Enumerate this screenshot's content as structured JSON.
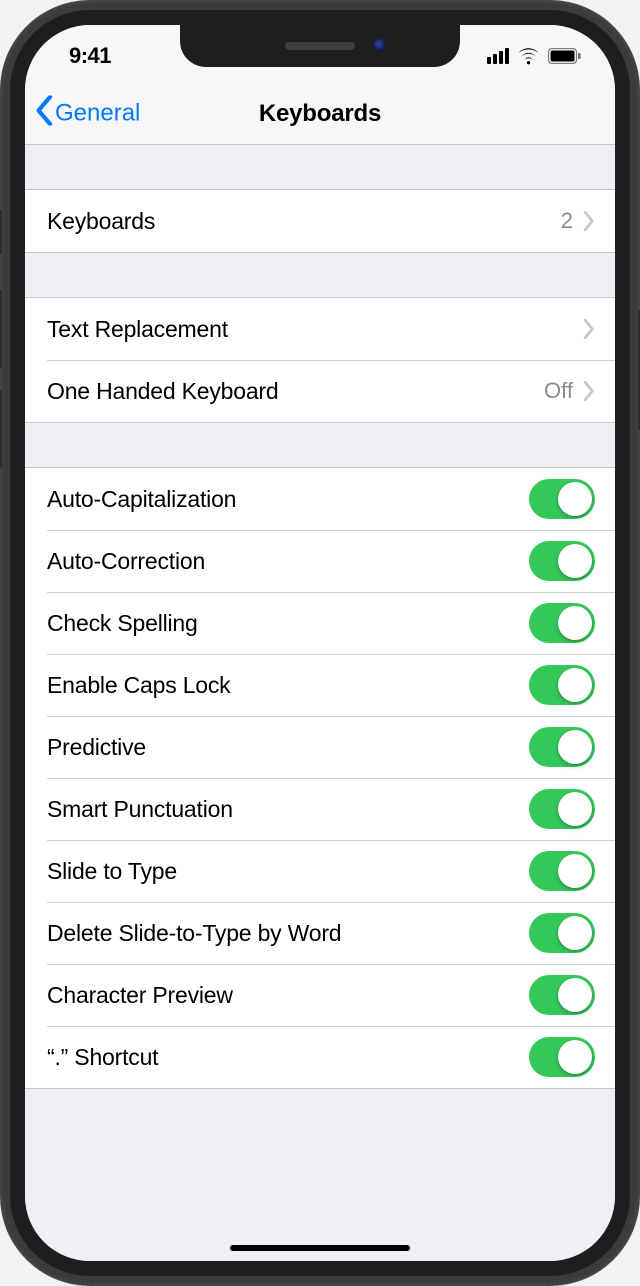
{
  "status": {
    "time": "9:41"
  },
  "nav": {
    "back_label": "General",
    "title": "Keyboards"
  },
  "group1": {
    "keyboards_label": "Keyboards",
    "keyboards_count": "2"
  },
  "group2": {
    "text_replacement_label": "Text Replacement",
    "one_handed_label": "One Handed Keyboard",
    "one_handed_value": "Off"
  },
  "toggles": [
    {
      "label": "Auto-Capitalization",
      "on": true
    },
    {
      "label": "Auto-Correction",
      "on": true
    },
    {
      "label": "Check Spelling",
      "on": true
    },
    {
      "label": "Enable Caps Lock",
      "on": true
    },
    {
      "label": "Predictive",
      "on": true
    },
    {
      "label": "Smart Punctuation",
      "on": true
    },
    {
      "label": "Slide to Type",
      "on": true
    },
    {
      "label": "Delete Slide-to-Type by Word",
      "on": true
    },
    {
      "label": "Character Preview",
      "on": true
    },
    {
      "label": "“.” Shortcut",
      "on": true
    }
  ],
  "colors": {
    "tint": "#007aff",
    "switch_on": "#34c759",
    "separator": "#d1d1d5",
    "secondary_text": "#8a8a8e",
    "group_bg": "#efeff4"
  }
}
